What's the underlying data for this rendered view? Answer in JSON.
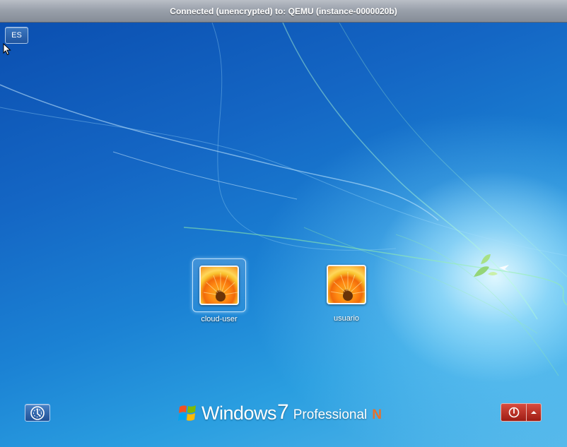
{
  "vnc": {
    "title": "Connected (unencrypted) to: QEMU (instance-0000020b)"
  },
  "login": {
    "language_indicator": "ES",
    "users": [
      {
        "name": "cloud-user",
        "selected": true,
        "avatar": "orange-flower-icon"
      },
      {
        "name": "usuario",
        "selected": false,
        "avatar": "orange-flower-icon"
      }
    ]
  },
  "footer": {
    "ease_of_access_icon": "ease-of-access-icon",
    "brand": {
      "logo_icon": "windows-flag-icon",
      "word": "Windows",
      "version": "7",
      "edition": "Professional",
      "suffix": "N"
    },
    "shutdown_icon": "power-icon",
    "options_icon": "chevron-up-icon"
  },
  "colors": {
    "power_button": "#c0392b",
    "brand_suffix": "#e8702a",
    "desktop_blue": "#1a73c7"
  }
}
